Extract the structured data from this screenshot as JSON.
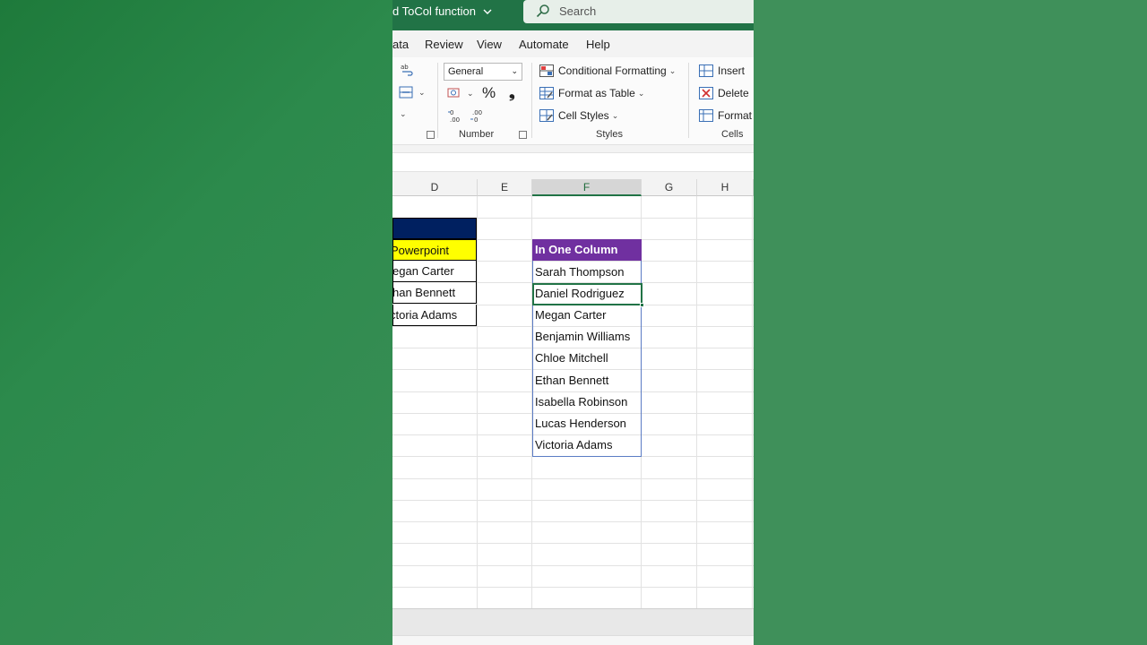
{
  "window": {
    "doc_title": "d ToCol function",
    "search_placeholder": "Search"
  },
  "tabs": [
    "ata",
    "Review",
    "View",
    "Automate",
    "Help"
  ],
  "ribbon": {
    "number_format": "General",
    "number_label": "Number",
    "styles_label": "Styles",
    "cells_label": "Cells",
    "percent_symbol": "%",
    "comma_symbol": "❟",
    "conditional_formatting": "Conditional Formatting",
    "format_as_table": "Format as Table",
    "cell_styles": "Cell Styles",
    "insert": "Insert",
    "delete": "Delete",
    "format": "Format",
    "inc_decimal": "←0\n.00",
    "dec_decimal": ".00\n→0"
  },
  "columns": [
    "D",
    "E",
    "F",
    "G",
    "H"
  ],
  "column_d": {
    "header": "",
    "yellow": "Powerpoint",
    "rows": [
      "egan Carter",
      "han Bennett",
      "ctoria Adams"
    ]
  },
  "column_f": {
    "header": "In One Column",
    "rows": [
      "Sarah Thompson",
      "Daniel Rodriguez",
      "Megan Carter",
      "Benjamin Williams",
      "Chloe Mitchell",
      "Ethan Bennett",
      "Isabella Robinson",
      "Lucas Henderson",
      "Victoria Adams"
    ]
  },
  "colors": {
    "excel_green": "#217346",
    "navy_header": "#002060",
    "yellow_header": "#ffff00",
    "purple_header": "#7030a0"
  }
}
